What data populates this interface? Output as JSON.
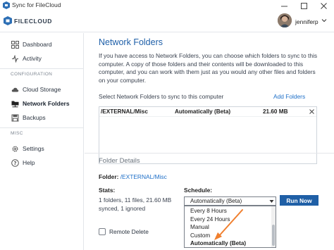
{
  "window": {
    "title": "Sync for FileCloud",
    "icon": "filecloud-app-icon",
    "controls": [
      "minimize-icon",
      "maximize-icon",
      "close-icon"
    ]
  },
  "header": {
    "logo_text": "FILECLOUD",
    "username": "jenniferp"
  },
  "sidebar": {
    "items": [
      {
        "label": "Dashboard",
        "icon": "dashboard-icon"
      },
      {
        "label": "Activity",
        "icon": "activity-icon"
      }
    ],
    "configuration_label": "CONFIGURATION",
    "config_items": [
      {
        "label": "Cloud Storage",
        "icon": "cloud-icon"
      },
      {
        "label": "Network Folders",
        "icon": "network-folders-icon",
        "active": true
      },
      {
        "label": "Backups",
        "icon": "backups-icon"
      }
    ],
    "misc_label": "MISC",
    "misc_items": [
      {
        "label": "Settings",
        "icon": "gear-icon"
      },
      {
        "label": "Help",
        "icon": "help-icon"
      }
    ]
  },
  "main": {
    "title": "Network Folders",
    "description": "If you have access to Network Folders, you can choose which folders to sync to this computer. A copy of those folders and their contents will be downloaded to this computer, and you can work with them just as you would any other files and folders on your computer.",
    "select_label": "Select Network Folders to sync to this computer",
    "add_folders_label": "Add Folders",
    "folders": [
      {
        "path": "/EXTERNAL/Misc",
        "schedule": "Automatically (Beta)",
        "size": "21.60 MB"
      }
    ],
    "details": {
      "title": "Folder Details",
      "folder_label": "Folder:",
      "folder_path": "/EXTERNAL/Misc",
      "stats_label": "Stats:",
      "stats_value": "1 folders, 11 files, 21.60 MB synced, 1 ignored",
      "schedule_label": "Schedule:",
      "schedule_value": "Automatically (Beta)",
      "schedule_options": [
        "Every 8 Hours",
        "Every 24 Hours",
        "Manual",
        "Custom",
        "Automatically (Beta)"
      ],
      "run_button": "Run Now",
      "remote_delete_label": "Remote Delete",
      "remote_delete_checked": false
    }
  },
  "colors": {
    "accent": "#1f5fa6",
    "link": "#1e6fc8",
    "arrow": "#f07f2e"
  }
}
